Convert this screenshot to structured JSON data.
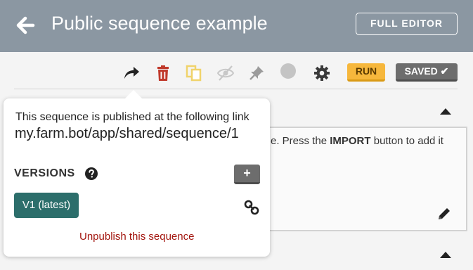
{
  "header": {
    "title": "Public sequence example",
    "full_editor_label": "FULL EDITOR"
  },
  "toolbar": {
    "run_label": "RUN",
    "saved_label": "SAVED ✔",
    "icons": [
      "share-icon",
      "trash-icon",
      "copy-icon",
      "visibility-off-icon",
      "pin-icon",
      "color-dot-icon",
      "gear-icon"
    ]
  },
  "description": {
    "text_before": "e. Press the ",
    "text_bold": "IMPORT",
    "text_after": " button to add it"
  },
  "popover": {
    "published_text": "This sequence is published at the following link",
    "link": "my.farm.bot/app/shared/sequence/1",
    "versions_label": "VERSIONS",
    "add_label": "+",
    "version_chip": "V1 (latest)",
    "unpublish_label": "Unpublish this sequence"
  },
  "colors": {
    "header_bg": "#8b97a2",
    "run": "#f6b73c",
    "saved": "#6d6d6d",
    "version_chip": "#2c6e6b",
    "unpublish": "#a3160f",
    "trash": "#c0392b",
    "copy": "#f0d36b"
  }
}
